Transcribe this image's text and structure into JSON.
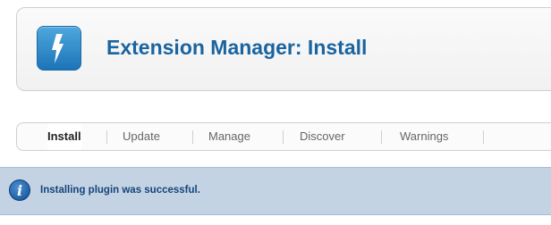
{
  "header": {
    "title": "Extension Manager: Install",
    "icon": "lightning-bolt-icon",
    "icon_color": "#2a86c9",
    "title_color": "#1a64a0"
  },
  "tabs": [
    {
      "label": "Install",
      "active": true
    },
    {
      "label": "Update",
      "active": false
    },
    {
      "label": "Manage",
      "active": false
    },
    {
      "label": "Discover",
      "active": false
    },
    {
      "label": "Warnings",
      "active": false
    }
  ],
  "message": {
    "text": "Installing plugin was successful.",
    "icon": "info-icon",
    "icon_glyph": "i",
    "background": "#c4d3e4"
  }
}
